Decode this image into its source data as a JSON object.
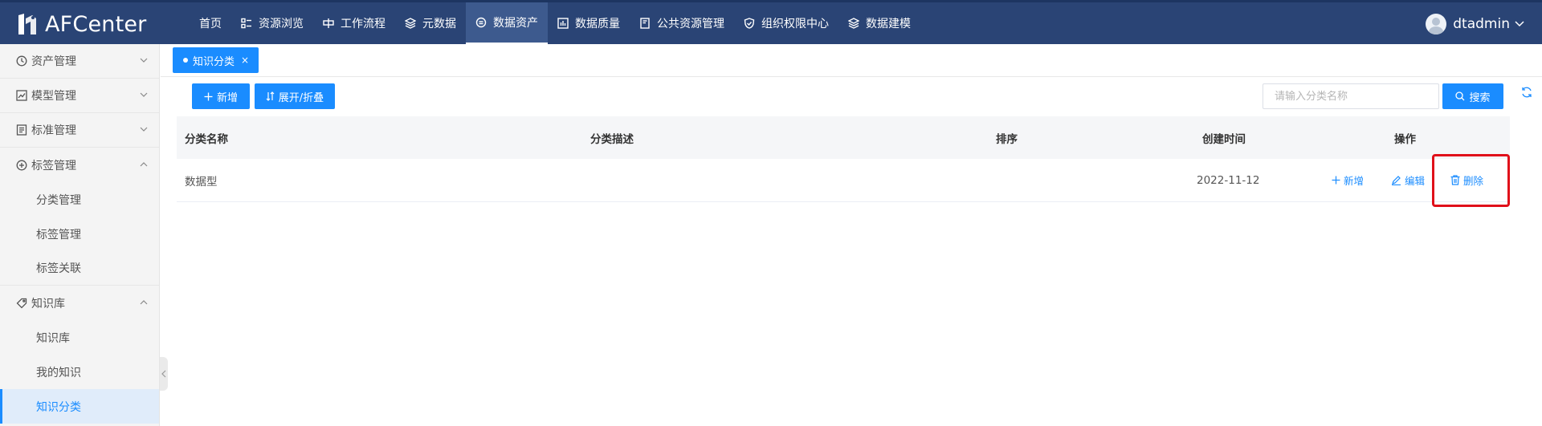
{
  "app": {
    "logo_text": "AFCenter"
  },
  "nav": {
    "items": [
      {
        "label": "首页",
        "icon": ""
      },
      {
        "label": "资源浏览",
        "icon": "grid-icon"
      },
      {
        "label": "工作流程",
        "icon": "workflow-icon"
      },
      {
        "label": "元数据",
        "icon": "layers-icon"
      },
      {
        "label": "数据资产",
        "icon": "asset-icon",
        "active": true
      },
      {
        "label": "数据质量",
        "icon": "chart-icon"
      },
      {
        "label": "公共资源管理",
        "icon": "book-icon"
      },
      {
        "label": "组织权限中心",
        "icon": "shield-icon"
      },
      {
        "label": "数据建模",
        "icon": "layers-icon"
      }
    ]
  },
  "user": {
    "name": "dtadmin"
  },
  "sidebar": {
    "groups": [
      {
        "label": "资产管理",
        "icon": "clock-icon",
        "expanded": false
      },
      {
        "label": "模型管理",
        "icon": "trend-icon",
        "expanded": false
      },
      {
        "label": "标准管理",
        "icon": "document-icon",
        "expanded": false
      },
      {
        "label": "标签管理",
        "icon": "plus-circle-icon",
        "expanded": true,
        "children": [
          "分类管理",
          "标签管理",
          "标签关联"
        ]
      },
      {
        "label": "知识库",
        "icon": "tag-icon",
        "expanded": true,
        "children": [
          "知识库",
          "我的知识",
          "知识分类"
        ]
      }
    ],
    "active": "知识分类"
  },
  "tabs": [
    {
      "label": "知识分类",
      "close": "×"
    }
  ],
  "toolbar": {
    "add_label": "新增",
    "expand_label": "展开/折叠",
    "search_placeholder": "请输入分类名称",
    "search_label": "搜索"
  },
  "table": {
    "headers": [
      "分类名称",
      "分类描述",
      "排序",
      "创建时间",
      "操作"
    ],
    "rows": [
      {
        "name": "数据型",
        "description": "",
        "order": "",
        "created": "2022-11-12"
      }
    ],
    "actions": {
      "add": "新增",
      "edit": "编辑",
      "delete": "删除"
    }
  },
  "colors": {
    "topbar": "#2a4475",
    "primary": "#1a8cff",
    "highlight": "#e0101a"
  }
}
